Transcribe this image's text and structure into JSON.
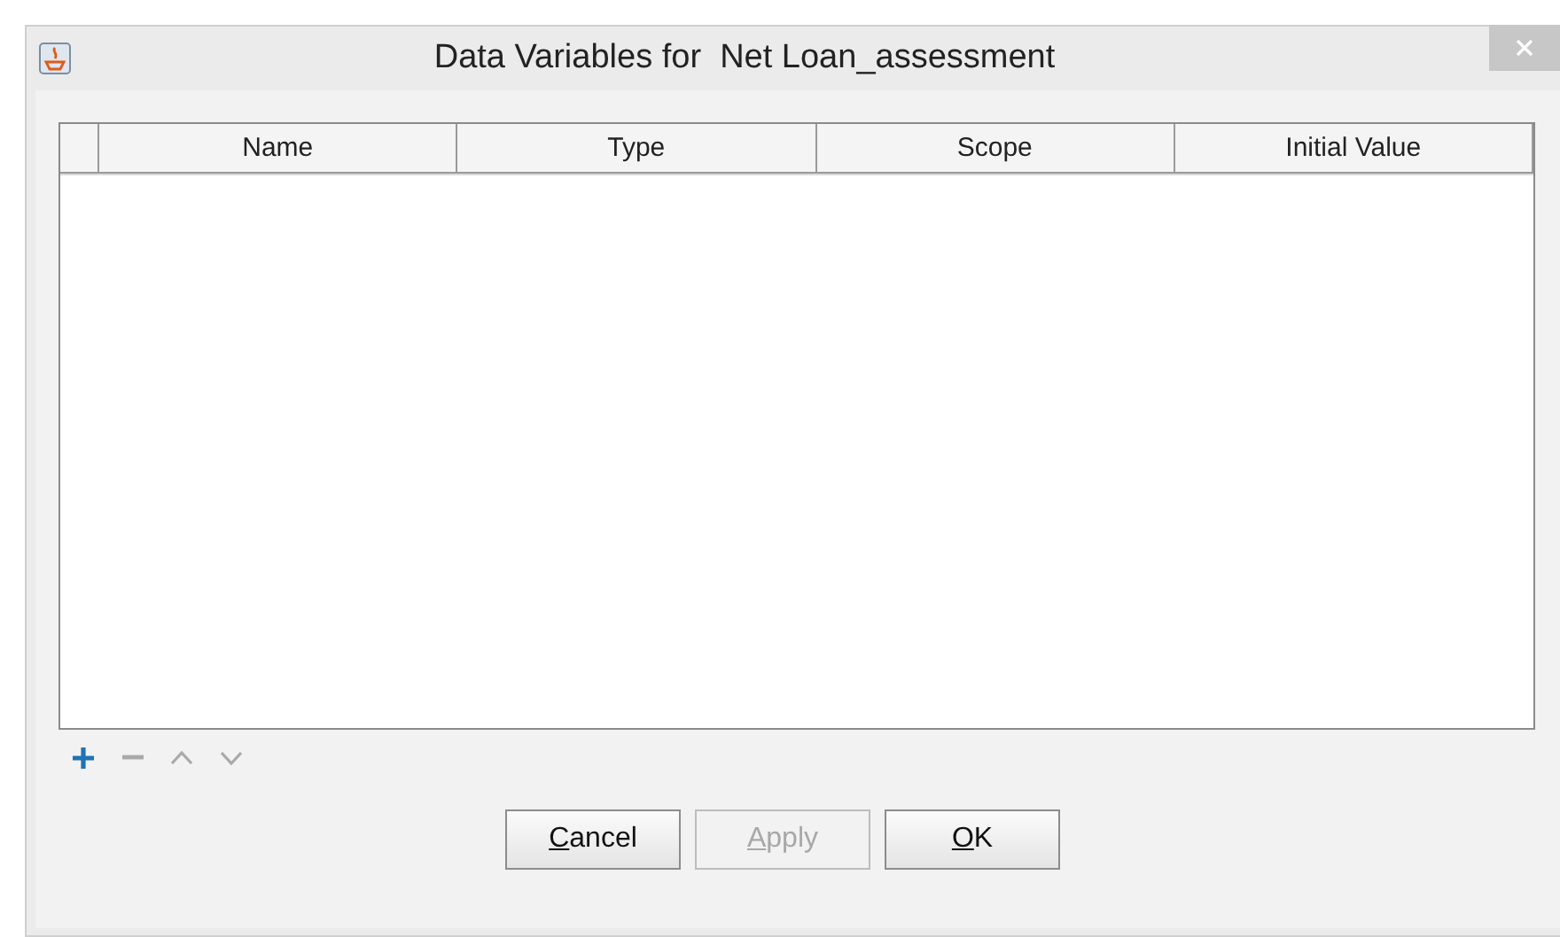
{
  "window": {
    "title": "Data Variables for  Net Loan_assessment"
  },
  "table": {
    "columns": [
      "Name",
      "Type",
      "Scope",
      "Initial Value"
    ]
  },
  "toolbar": [
    {
      "kind": "add",
      "disabled": false
    },
    {
      "kind": "remove",
      "disabled": true
    },
    {
      "kind": "up",
      "disabled": true
    },
    {
      "kind": "down",
      "disabled": true
    }
  ],
  "buttons": [
    {
      "label": "Cancel",
      "disabled": false,
      "mnemonic_underlined": true
    },
    {
      "label": "Apply",
      "disabled": true,
      "mnemonic_underlined": true
    },
    {
      "label": "OK",
      "disabled": false,
      "mnemonic_underlined": true
    }
  ]
}
